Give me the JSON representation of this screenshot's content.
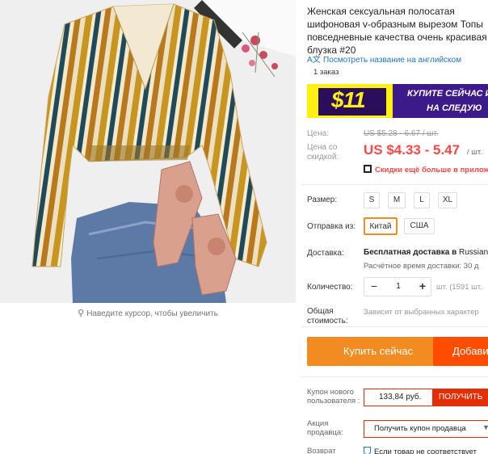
{
  "product": {
    "title": "Женская сексуальная полосатая шифоновая v-образным вырезом Топы повседневные качества очень красивая блузка #20",
    "translate_link": "Посмотреть название на английском",
    "orders": "1 заказ",
    "zoom_hint": "Наведите курсор, чтобы увеличить"
  },
  "banner": {
    "amount": "$11",
    "line1": "КУПИТЕ СЕЙЧАС И",
    "line2": "НА СЛЕДУЮ"
  },
  "price": {
    "label": "Цена:",
    "old": "US $5.28 - 6.67 / шт.",
    "discount_label": "Цена со скидкой:",
    "sale": "US $4.33 - 5.47",
    "per_unit": "/ шт.",
    "coupon_promo": "Скидки ещё больше в прилож"
  },
  "size": {
    "label": "Размер:",
    "options": [
      "S",
      "M",
      "L",
      "XL"
    ]
  },
  "shipping_from": {
    "label": "Отправка из:",
    "options": [
      "Китай",
      "США"
    ],
    "selected": "Китай"
  },
  "delivery": {
    "label": "Доставка:",
    "free_text": "Бесплатная доставка в",
    "country": "Russian",
    "eta": "Расчётное время доставки: 30 д"
  },
  "quantity": {
    "label": "Количество:",
    "minus": "−",
    "value": "1",
    "plus": "+",
    "available": "шт. (1591 шт."
  },
  "total": {
    "label": "Общая стоимость:",
    "text": "Зависит от выбранных характер"
  },
  "actions": {
    "buy_now": "Купить сейчас",
    "add_to_cart": "Добави"
  },
  "new_user_coupon": {
    "label": "Купон нового пользователя :",
    "amount": "133,84 руб.",
    "get": "ПОЛУЧИТЬ"
  },
  "seller_promo": {
    "label": "Акция продавца:",
    "select": "Получить купон продавца",
    "arrow": "▼"
  },
  "returns": {
    "label": "Возврат",
    "text": "Если товар не соответствует"
  },
  "colors": {
    "price_red": "#ff4747",
    "buy_orange": "#f28b21",
    "cart_orange": "#ff4d00",
    "link_blue": "#2273c5",
    "banner_yellow": "#fff014",
    "banner_purple": "#3d1a8a"
  }
}
